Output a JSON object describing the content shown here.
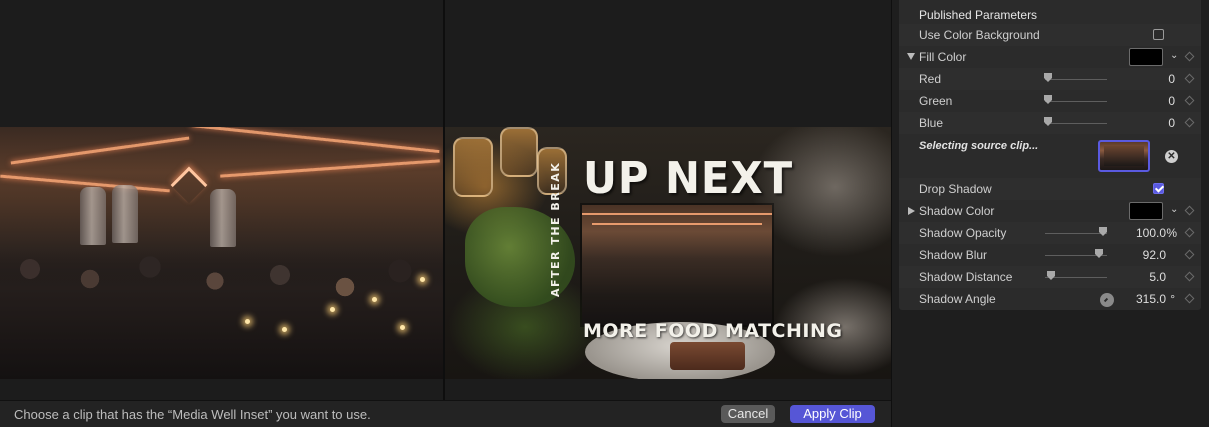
{
  "viewer": {
    "overlay": {
      "up_next": "UP NEXT",
      "after_the_break": "AFTER THE BREAK",
      "more_food": "MORE FOOD MATCHING"
    }
  },
  "bottom_bar": {
    "hint": "Choose a clip that has the “Media Well Inset” you want to use.",
    "cancel_label": "Cancel",
    "apply_label": "Apply Clip"
  },
  "inspector": {
    "section_title": "Published Parameters",
    "use_color_background": {
      "label": "Use Color Background",
      "checked": false
    },
    "fill_color": {
      "label": "Fill Color",
      "color": "#000000",
      "expanded": true
    },
    "red": {
      "label": "Red",
      "value": "0",
      "level": 0
    },
    "green": {
      "label": "Green",
      "value": "0",
      "level": 0
    },
    "blue": {
      "label": "Blue",
      "value": "0",
      "level": 0
    },
    "source_clip": {
      "label": "Selecting source clip..."
    },
    "drop_shadow": {
      "label": "Drop Shadow",
      "checked": true
    },
    "shadow_color": {
      "label": "Shadow Color",
      "color": "#000000",
      "expanded": false
    },
    "shadow_opacity": {
      "label": "Shadow Opacity",
      "value": "100.0",
      "unit": "%"
    },
    "shadow_blur": {
      "label": "Shadow Blur",
      "value": "92.0"
    },
    "shadow_distance": {
      "label": "Shadow Distance",
      "value": "5.0"
    },
    "shadow_angle": {
      "label": "Shadow Angle",
      "value": "315.0",
      "unit": "°"
    }
  },
  "colors": {
    "accent": "#5656d6",
    "panel": "#2b2b2b",
    "background": "#1a1a1a"
  }
}
